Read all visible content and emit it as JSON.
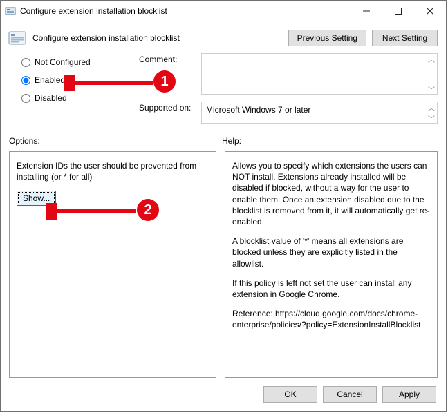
{
  "window": {
    "title": "Configure extension installation blocklist"
  },
  "header": {
    "title": "Configure extension installation blocklist",
    "prev_btn": "Previous Setting",
    "next_btn": "Next Setting"
  },
  "radios": {
    "not_configured": "Not Configured",
    "enabled": "Enabled",
    "disabled": "Disabled",
    "selected": "enabled"
  },
  "comment": {
    "label": "Comment:",
    "value": ""
  },
  "supported": {
    "label": "Supported on:",
    "value": "Microsoft Windows 7 or later"
  },
  "sections": {
    "options_label": "Options:",
    "help_label": "Help:"
  },
  "options": {
    "description": "Extension IDs the user should be prevented from installing (or * for all)",
    "show_btn": "Show..."
  },
  "help": {
    "p1": "Allows you to specify which extensions the users can NOT install. Extensions already installed will be disabled if blocked, without a way for the user to enable them. Once an extension disabled due to the blocklist is removed from it, it will automatically get re-enabled.",
    "p2": "A blocklist value of '*' means all extensions are blocked unless they are explicitly listed in the allowlist.",
    "p3": "If this policy is left not set the user can install any extension in Google Chrome.",
    "p4": "Reference: https://cloud.google.com/docs/chrome-enterprise/policies/?policy=ExtensionInstallBlocklist"
  },
  "buttons": {
    "ok": "OK",
    "cancel": "Cancel",
    "apply": "Apply"
  },
  "annotations": {
    "n1": "1",
    "n2": "2"
  }
}
